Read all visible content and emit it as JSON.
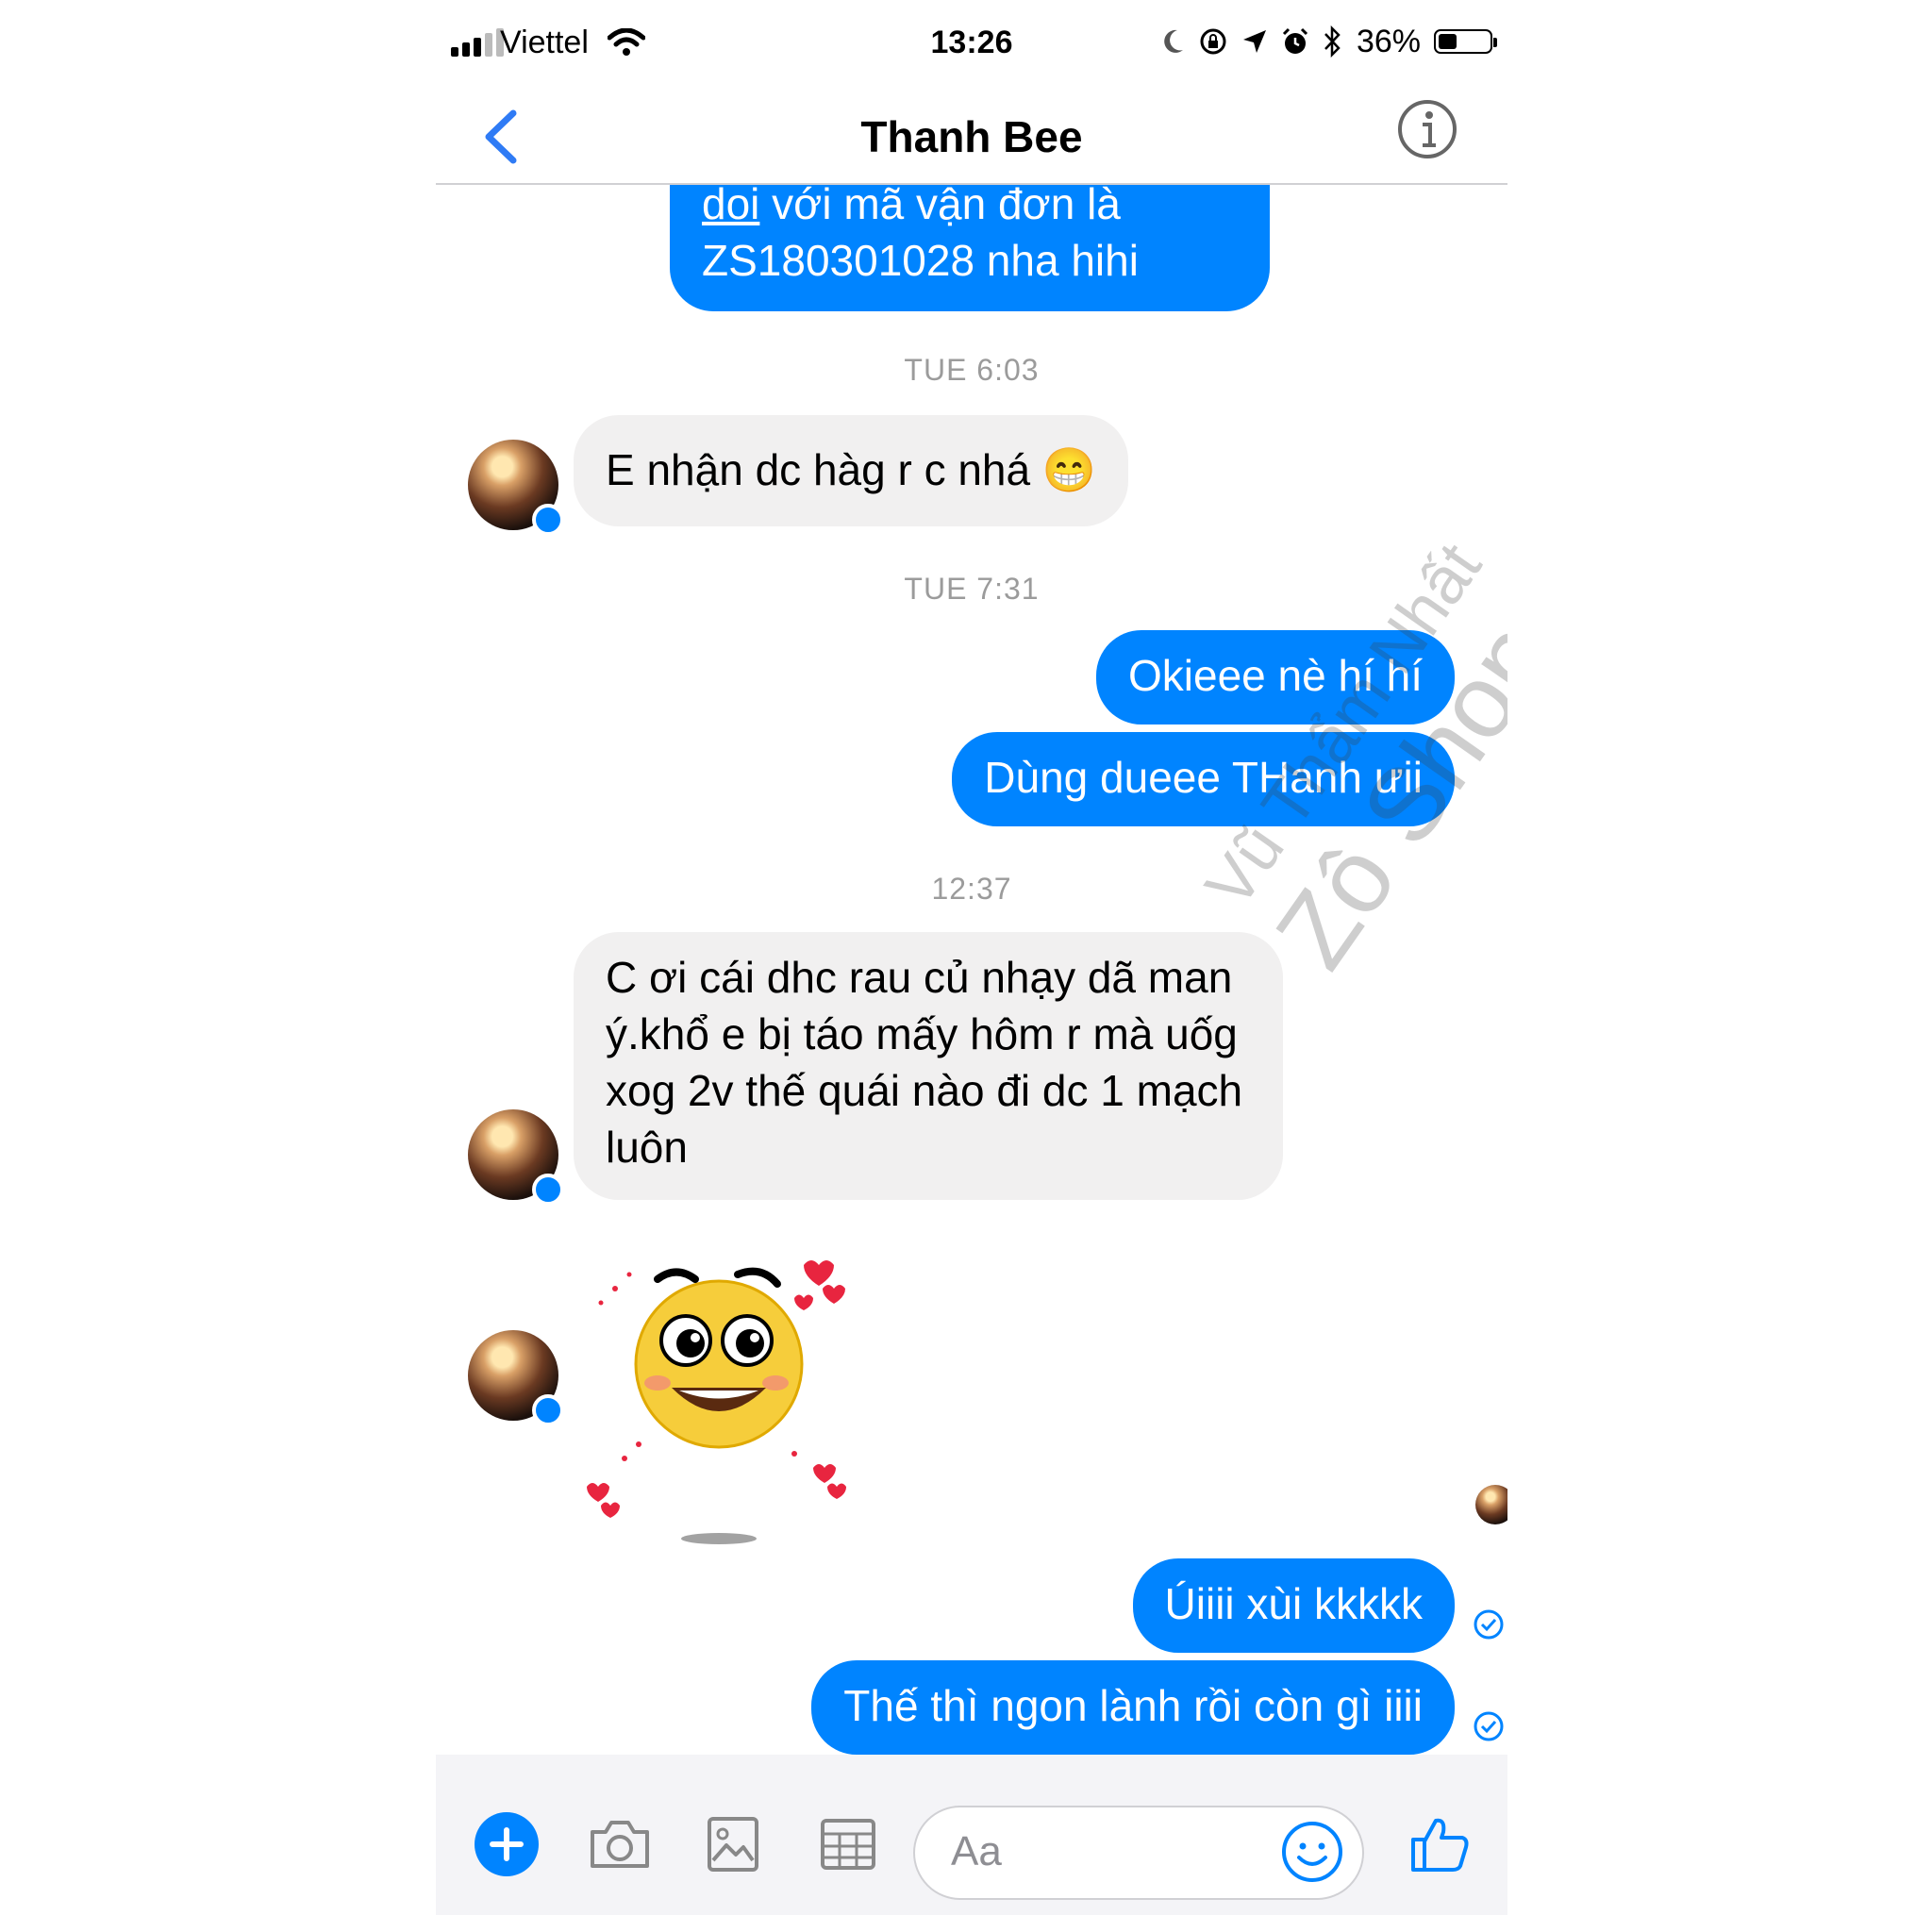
{
  "status_bar": {
    "carrier": "Viettel",
    "time": "13:26",
    "battery": "36%",
    "battery_level": 0.36
  },
  "header": {
    "title": "Thanh Bee"
  },
  "messages": [
    {
      "from": "me",
      "text": "doi với mã vận đơn là ZS180301028 nha hihi",
      "underlined_word": "doi",
      "rest": " với mã vận đơn là ZS180301028 nha hihi"
    },
    {
      "type": "timestamp",
      "text": "TUE 6:03"
    },
    {
      "from": "them",
      "text": "E nhận dc hàg r c nhá 😁"
    },
    {
      "type": "timestamp",
      "text": "TUE 7:31"
    },
    {
      "from": "me",
      "text": "Okieee nè hí hí"
    },
    {
      "from": "me",
      "text": "Dùng dueee THanh ưii"
    },
    {
      "type": "timestamp",
      "text": "12:37"
    },
    {
      "from": "them",
      "text": "C ơi cái dhc rau củ nhạy dã man ý.khổ e bị táo mấy hôm r mà uốg xog 2v thế quái nào đi dc 1 mạch luôn"
    },
    {
      "from": "them",
      "type": "sticker",
      "icon": "smiling-face-with-hearts-sticker"
    },
    {
      "from": "me",
      "text": "Úiiii xùi kkkkk"
    },
    {
      "from": "me",
      "text": "Thế thì ngon lành rồi còn gì iiii"
    }
  ],
  "composer": {
    "placeholder": "Aa"
  },
  "watermark": {
    "line1": "Vũ Thẩm Nhất",
    "line2": "Zô Shop"
  },
  "colors": {
    "accent": "#0084ff",
    "incoming_bubble": "#f1f0f0",
    "timestamp": "#9b9b9b"
  }
}
